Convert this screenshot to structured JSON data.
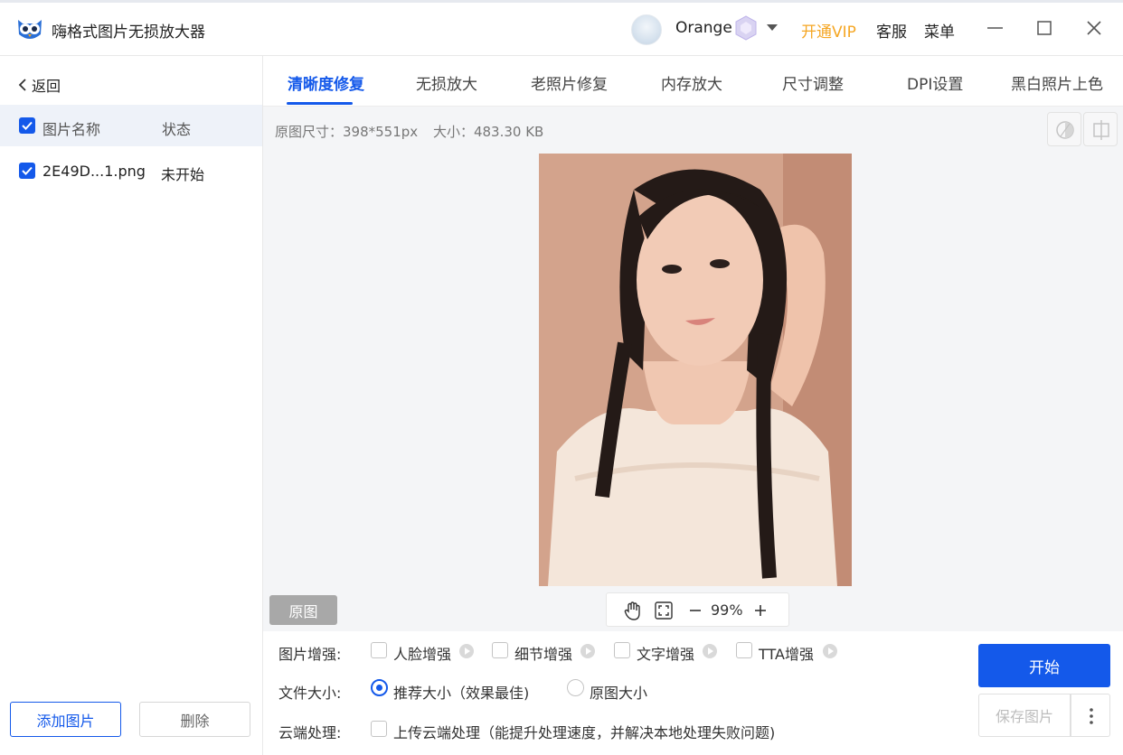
{
  "app": {
    "title": "嗨格式图片无损放大器"
  },
  "user": {
    "name": "Orange",
    "vip_label": "开通VIP",
    "support_label": "客服",
    "menu_label": "菜单"
  },
  "sidebar": {
    "back_label": "返回",
    "header": {
      "name": "图片名称",
      "status": "状态"
    },
    "files": [
      {
        "name": "2E49D...1.png",
        "status": "未开始",
        "checked": true
      }
    ],
    "add_label": "添加图片",
    "delete_label": "删除"
  },
  "tabs": [
    {
      "label": "清晰度修复",
      "active": true
    },
    {
      "label": "无损放大"
    },
    {
      "label": "老照片修复"
    },
    {
      "label": "内存放大"
    },
    {
      "label": "尺寸调整"
    },
    {
      "label": "DPI设置"
    },
    {
      "label": "黑白照片上色"
    }
  ],
  "image_info": {
    "size": "原图尺寸：398*551px",
    "filesize": "大小：483.30 KB"
  },
  "viewer": {
    "original_label": "原图",
    "zoom": "99%"
  },
  "options": {
    "enhance_label": "图片增强:",
    "enhance": [
      "人脸增强",
      "细节增强",
      "文字增强",
      "TTA增强"
    ],
    "filesize_label": "文件大小:",
    "filesize_options": [
      {
        "label": "推荐大小（效果最佳)",
        "selected": true
      },
      {
        "label": "原图大小",
        "selected": false
      }
    ],
    "cloud_label": "云端处理:",
    "cloud_option": "上传云端处理（能提升处理速度，并解决本地处理失败问题)"
  },
  "actions": {
    "start_label": "开始",
    "save_label": "保存图片"
  },
  "colors": {
    "accent": "#1459ea",
    "vip": "#f5a623"
  }
}
